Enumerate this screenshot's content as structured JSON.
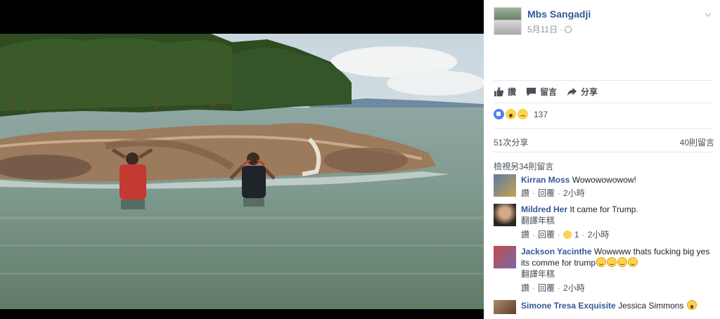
{
  "post": {
    "author": "Mbs Sangadji",
    "date": "5月11日",
    "privacy_icon": "globe-icon"
  },
  "actions": {
    "like": "讚",
    "comment": "留言",
    "share": "分享"
  },
  "reactions": {
    "icons": [
      "like",
      "wow",
      "sad"
    ],
    "count": "137"
  },
  "stats": {
    "shares": "51次分享",
    "comments": "40則留言"
  },
  "view_more": "檢視另34則留言",
  "comments": [
    {
      "name": "Kirran Moss",
      "text": "Wowowowowow!",
      "like": "讚",
      "reply": "回覆",
      "time": "2小時"
    },
    {
      "name": "Mildred Her",
      "text": "It came for Trump.",
      "translate": "翻譯年糕",
      "like": "讚",
      "reply": "回覆",
      "reaction_count": "1",
      "time": "2小時"
    },
    {
      "name": "Jackson Yacinthe",
      "text": "Wowwww thats fucking big yes its comme for trump",
      "translate": "翻譯年糕",
      "like": "讚",
      "reply": "回覆",
      "time": "2小時"
    },
    {
      "name": "Simone Tresa Exquisite",
      "text": "Jessica Simmons"
    }
  ],
  "colors": {
    "link": "#365899",
    "muted": "#90949c",
    "divider": "#e5e6e9"
  }
}
